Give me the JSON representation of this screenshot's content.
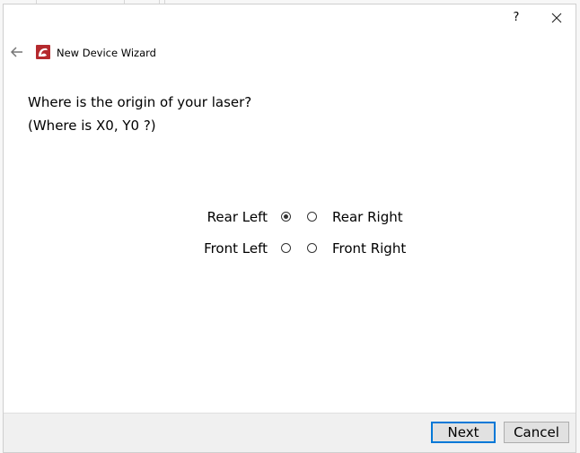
{
  "titlebar": {
    "help_label": "?",
    "close_icon": "close-icon"
  },
  "header": {
    "back_icon": "back-arrow-icon",
    "app_icon": "app-logo-icon",
    "title": "New Device Wizard"
  },
  "question": {
    "line1": "Where is the origin of your laser?",
    "line2": "(Where is X0, Y0 ?)"
  },
  "options": {
    "rows": [
      {
        "left_label": "Rear Left",
        "right_label": "Rear Right",
        "left_checked": true,
        "right_checked": false
      },
      {
        "left_label": "Front Left",
        "right_label": "Front Right",
        "left_checked": false,
        "right_checked": false
      }
    ],
    "selected": "Rear Left"
  },
  "footer": {
    "next_label": "Next",
    "cancel_label": "Cancel"
  },
  "colors": {
    "accent": "#0078d7",
    "logo": "#b52a2e"
  }
}
